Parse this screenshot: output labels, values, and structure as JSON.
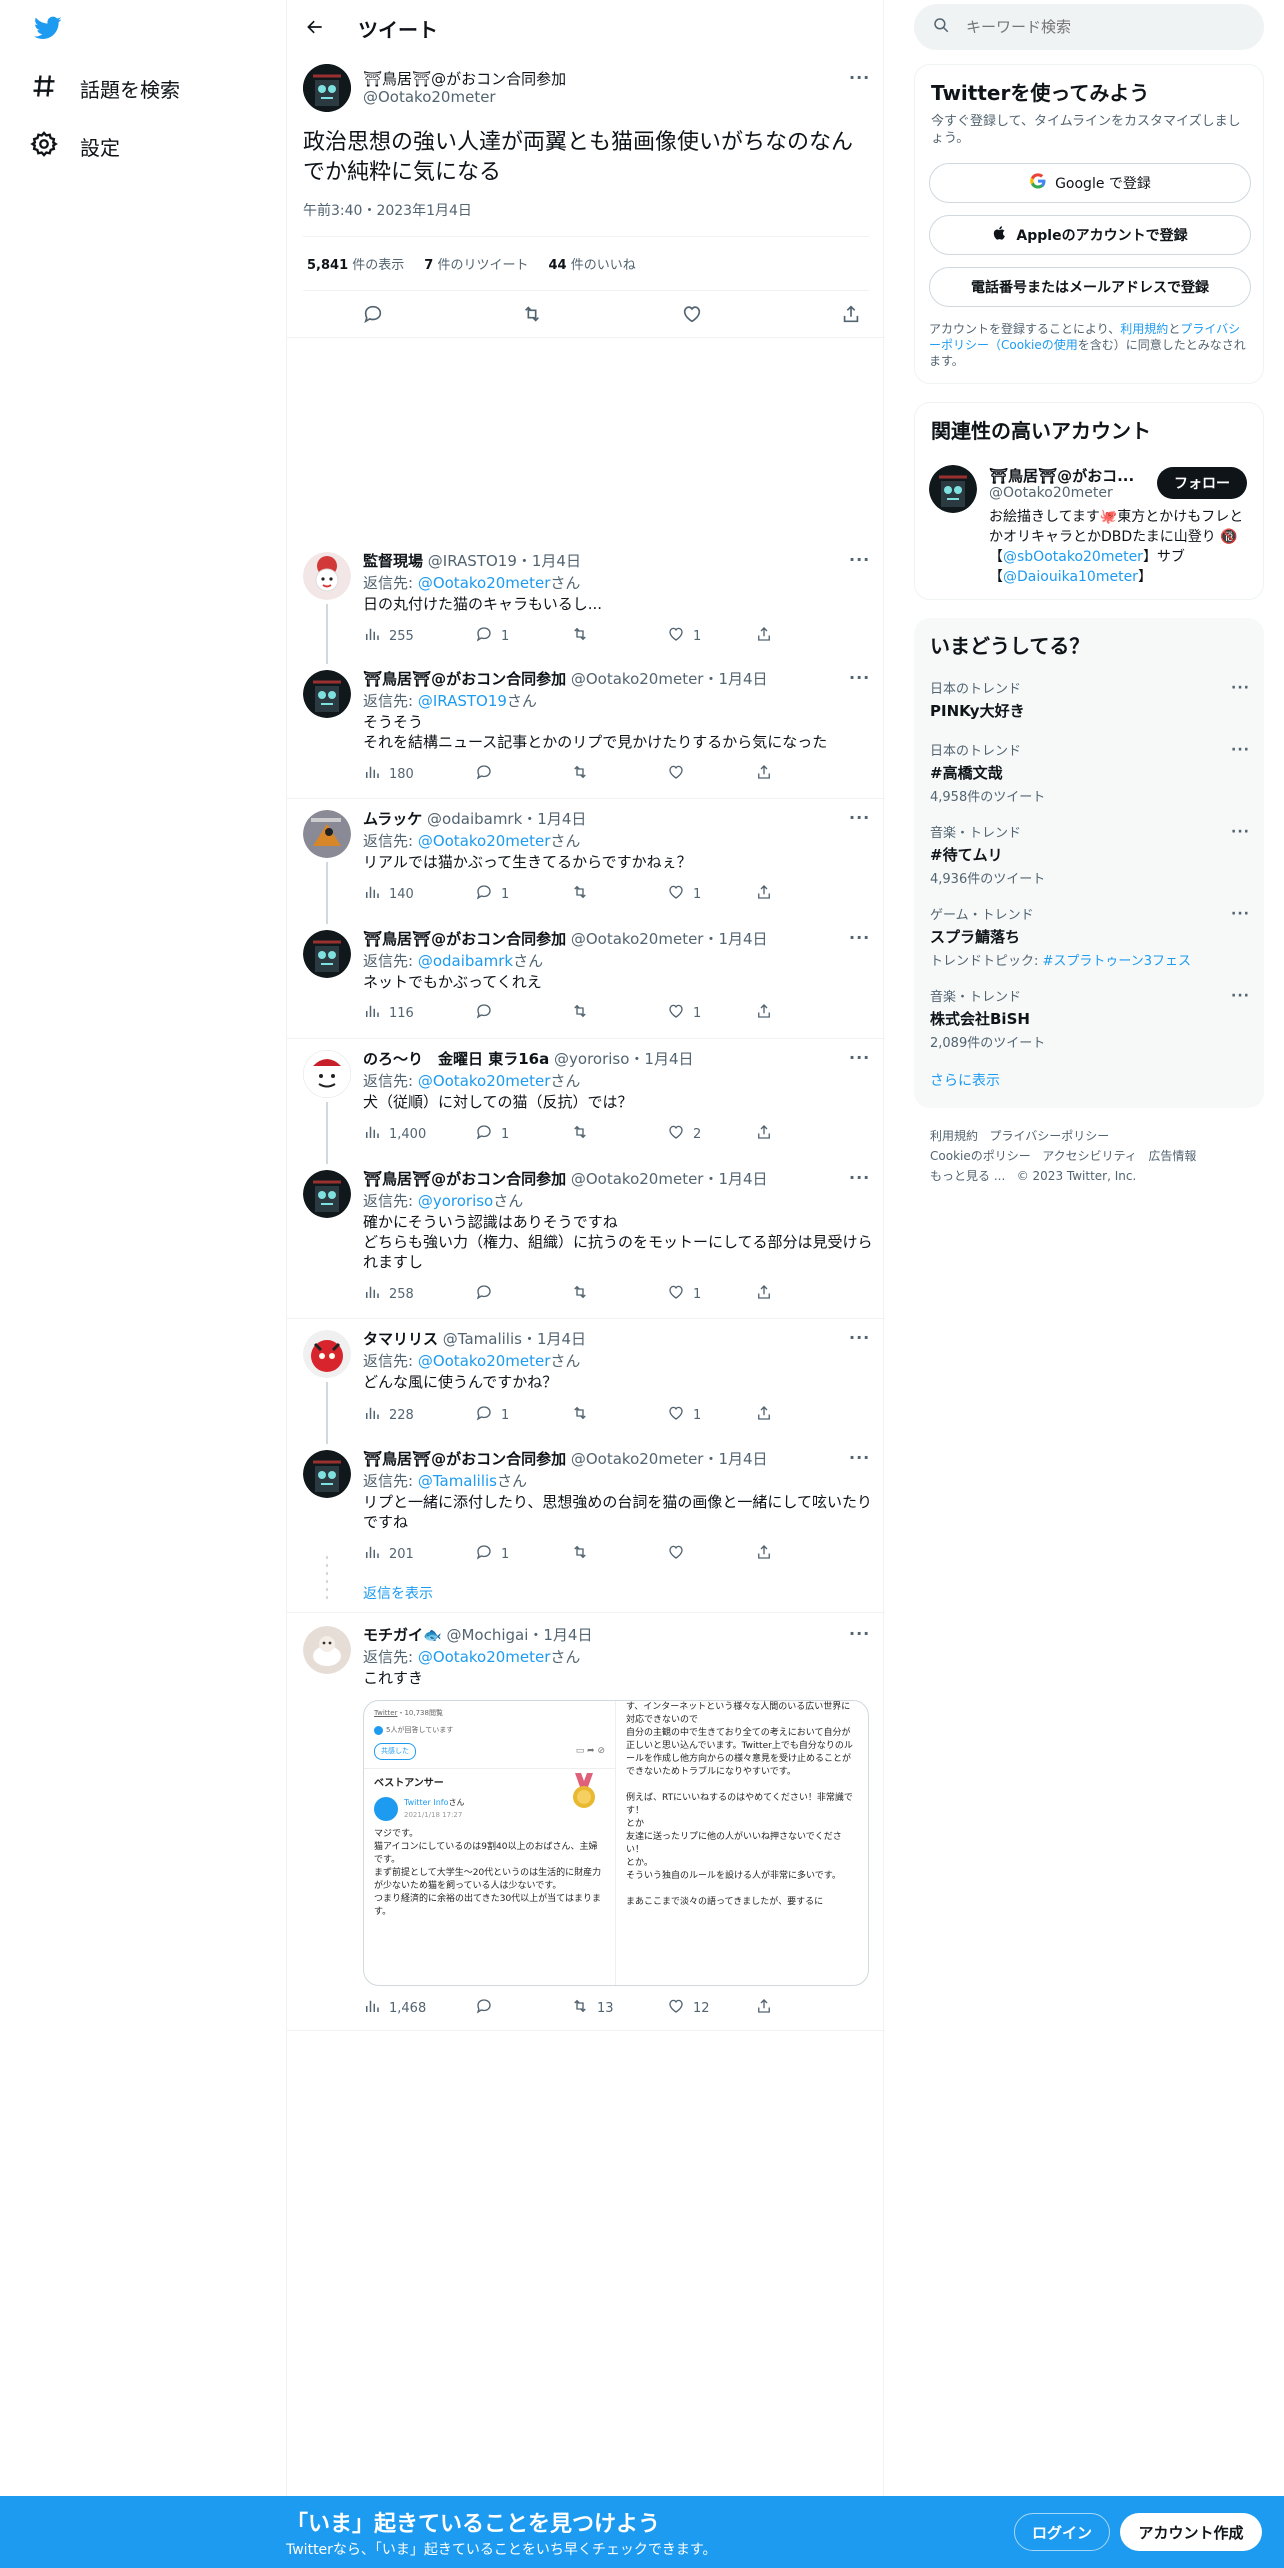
{
  "leftnav": {
    "explore": "話題を検索",
    "settings": "設定"
  },
  "header": {
    "title": "ツイート"
  },
  "tweet": {
    "display_name": "⛩鳥居⛩@がおコン合同参加",
    "handle": "@Ootako20meter",
    "text": "政治思想の強い人達が両翼とも猫画像使いがちなのなんでか純粋に気になる",
    "time": "午前3:40・2023年1月4日",
    "views_num": "5,841",
    "views_label": "件の表示",
    "retweets_num": "7",
    "retweets_label": "件のリツイート",
    "likes_num": "44",
    "likes_label": "件のいいね"
  },
  "replies": [
    {
      "name": "監督現場",
      "handle": "@IRASTO19",
      "date": "・1月4日",
      "reply_prefix": "返信先: ",
      "reply_to": "@Ootako20meter",
      "reply_suffix": "さん",
      "lines": [
        "日の丸付けた猫のキャラもいるし..."
      ],
      "views": "255",
      "replies": "1",
      "retweets": "",
      "likes": "1"
    },
    {
      "name": "⛩鳥居⛩@がおコン合同参加",
      "handle": "@Ootako20meter",
      "date": "・1月4日",
      "reply_prefix": "返信先: ",
      "reply_to": "@IRASTO19",
      "reply_suffix": "さん",
      "lines": [
        "そうそう",
        "それを結構ニュース記事とかのリプで見かけたりするから気になった"
      ],
      "views": "180",
      "replies": "",
      "retweets": "",
      "likes": ""
    },
    {
      "name": "ムラッケ",
      "handle": "@odaibamrk",
      "date": "・1月4日",
      "reply_prefix": "返信先: ",
      "reply_to": "@Ootako20meter",
      "reply_suffix": "さん",
      "lines": [
        "リアルでは猫かぶって生きてるからですかねぇ？"
      ],
      "views": "140",
      "replies": "1",
      "retweets": "",
      "likes": "1"
    },
    {
      "name": "⛩鳥居⛩@がおコン合同参加",
      "handle": "@Ootako20meter",
      "date": "・1月4日",
      "reply_prefix": "返信先: ",
      "reply_to": "@odaibamrk",
      "reply_suffix": "さん",
      "lines": [
        "ネットでもかぶってくれえ"
      ],
      "views": "116",
      "replies": "",
      "retweets": "",
      "likes": "1"
    },
    {
      "name": "のろ～り　金曜日 東ラ16a",
      "handle": "@yororiso",
      "date": "・1月4日",
      "reply_prefix": "返信先: ",
      "reply_to": "@Ootako20meter",
      "reply_suffix": "さん",
      "lines": [
        "犬（従順）に対しての猫（反抗）では？"
      ],
      "views": "1,400",
      "replies": "1",
      "retweets": "",
      "likes": "2"
    },
    {
      "name": "⛩鳥居⛩@がおコン合同参加",
      "handle": "@Ootako20meter",
      "date": "・1月4日",
      "reply_prefix": "返信先: ",
      "reply_to": "@yororiso",
      "reply_suffix": "さん",
      "lines": [
        "確かにそういう認識はありそうですね",
        "どちらも強い力（権力、組織）に抗うのをモットーにしてる部分は見受けられますし"
      ],
      "views": "258",
      "replies": "",
      "retweets": "",
      "likes": "1"
    },
    {
      "name": "タマリリス",
      "handle": "@Tamalilis",
      "date": "・1月4日",
      "reply_prefix": "返信先: ",
      "reply_to": "@Ootako20meter",
      "reply_suffix": "さん",
      "lines": [
        "どんな風に使うんですかね？"
      ],
      "views": "228",
      "replies": "1",
      "retweets": "",
      "likes": "1"
    },
    {
      "name": "⛩鳥居⛩@がおコン合同参加",
      "handle": "@Ootako20meter",
      "date": "・1月4日",
      "reply_prefix": "返信先: ",
      "reply_to": "@Tamalilis",
      "reply_suffix": "さん",
      "lines": [
        "リプと一緒に添付したり、思想強めの台詞を猫の画像と一緒にして呟いたりですね"
      ],
      "views": "201",
      "replies": "1",
      "retweets": "",
      "likes": ""
    },
    {
      "name": "モチガイ🐟",
      "handle": "@Mochigai",
      "date": "・1月4日",
      "reply_prefix": "返信先: ",
      "reply_to": "@Ootako20meter",
      "reply_suffix": "さん",
      "lines": [
        "これすき"
      ],
      "views": "1,468",
      "replies": "",
      "retweets": "13",
      "likes": "12"
    }
  ],
  "show_replies": "返信を表示",
  "embedded": {
    "left_site": "Twitter",
    "left_meta": "・10,738閲覧",
    "left_count": "5人が回答しています",
    "left_chip": "共感した",
    "best_answer": "ベストアンサー",
    "answerer": "Twitter Info",
    "answerer_suffix": "さん",
    "answer_date": "2021/1/18 17:27",
    "left_lines": [
      "マジです。",
      "猫アイコンにしているのは9割40以上のおばさん、主婦です。",
      "まず前提として大学生〜20代というのは生活的に財産力が少ないため猫を飼っている人は少ないです。",
      "つまり経済的に余裕の出てきた30代以上が当てはまります。"
    ],
    "right_lines": [
      "す、インターネットという様々な人間のいる広い世界に対応できないので",
      "自分の主観の中で生きており全ての考えにおいて自分が正しいと思い込んでいます。Twitter上でも自分なりのルールを作成し他方向からの様々意見を受け止めることができないためトラブルになりやすいです。",
      "",
      "例えば、RTにいいねするのはやめてください！非常識です！",
      "とか",
      "友達に送ったリプに他の人がいいね押さないでください！",
      "とか。",
      "そういう独自のルールを設ける人が非常に多いです。",
      "",
      "まあここまで淡々の語ってきましたが、要するに"
    ]
  },
  "right": {
    "search_placeholder": "キーワード検索",
    "signup_title": "Twitterを使ってみよう",
    "signup_sub": "今すぐ登録して、タイムラインをカスタマイズしましょう。",
    "google_btn": "Google で登録",
    "apple_btn": "Appleのアカウントで登録",
    "phone_btn": "電話番号またはメールアドレスで登録",
    "terms_1": "アカウントを登録することにより、",
    "terms_link1": "利用規約",
    "terms_2": "と",
    "terms_link2": "プライバシーポリシー（Cookieの使用",
    "terms_3": "を含む）に同意したとみなされます。",
    "relevant_title": "関連性の高いアカウント",
    "relevant_name": "⛩鳥居⛩@がおコ...",
    "relevant_handle": "@Ootako20meter",
    "follow_btn": "フォロー",
    "bio_1": "お絵描きしてます🐙東方とかけもフレとかオリキャラとかDBDたまに山登り 🔞 【",
    "bio_link1": "@sbOotako20meter",
    "bio_2": "】サブ【",
    "bio_link2": "@Daiouika10meter",
    "bio_3": "】",
    "trends_title": "いまどうしてる？",
    "trends": [
      {
        "cat": "日本のトレンド",
        "title": "PINKy大好き",
        "count": "",
        "topic_label": "",
        "topic_link": ""
      },
      {
        "cat": "日本のトレンド",
        "title": "#高橋文哉",
        "count": "4,958件のツイート",
        "topic_label": "",
        "topic_link": ""
      },
      {
        "cat": "音楽・トレンド",
        "title": "#待てムリ",
        "count": "4,936件のツイート",
        "topic_label": "",
        "topic_link": ""
      },
      {
        "cat": "ゲーム・トレンド",
        "title": "スプラ鯖落ち",
        "count": "",
        "topic_label": "トレンドトピック: ",
        "topic_link": "#スプラトゥーン3フェス"
      },
      {
        "cat": "音楽・トレンド",
        "title": "株式会社BiSH",
        "count": "2,089件のツイート",
        "topic_label": "",
        "topic_link": ""
      }
    ],
    "show_more": "さらに表示",
    "footer": {
      "tos": "利用規約",
      "privacy": "プライバシーポリシー",
      "cookie": "Cookieのポリシー",
      "access": "アクセシビリティ",
      "ads": "広告情報",
      "more": "もっと見る ...",
      "copy": "© 2023 Twitter, Inc."
    }
  },
  "bottombar": {
    "title": "「いま」起きていることを見つけよう",
    "sub": "Twitterなら、「いま」起きていることをいち早くチェックできます。",
    "login": "ログイン",
    "signup": "アカウント作成"
  },
  "colors": {
    "accent": "#1d9bf0",
    "text": "#0f1419",
    "muted": "#536471",
    "border": "#eff3f4"
  }
}
